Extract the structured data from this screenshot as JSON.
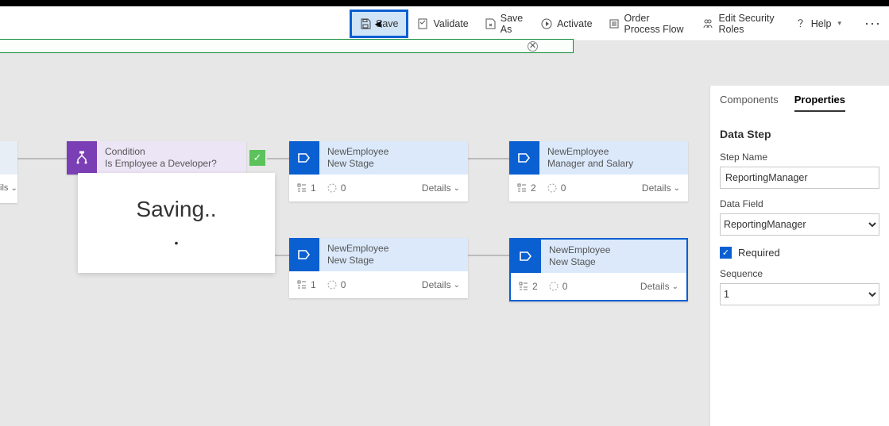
{
  "toolbar": {
    "save": "Save",
    "validate": "Validate",
    "save_as": "Save As",
    "activate": "Activate",
    "order": "Order Process Flow",
    "security": "Edit Security Roles",
    "help": "Help"
  },
  "saving_text": "Saving..",
  "partial_foot": "ils",
  "condition_node": {
    "line1": "Condition",
    "line2": "Is Employee a Developer?"
  },
  "stages": [
    {
      "line1": "NewEmployee",
      "line2": "New Stage",
      "count1": "1",
      "count2": "0",
      "details": "Details"
    },
    {
      "line1": "NewEmployee",
      "line2": "Manager and Salary",
      "count1": "2",
      "count2": "0",
      "details": "Details"
    },
    {
      "line1": "NewEmployee",
      "line2": "New Stage",
      "count1": "1",
      "count2": "0",
      "details": "Details"
    },
    {
      "line1": "NewEmployee",
      "line2": "New Stage",
      "count1": "2",
      "count2": "0",
      "details": "Details"
    }
  ],
  "tabs": {
    "components": "Components",
    "properties": "Properties"
  },
  "panel": {
    "heading": "Data Step",
    "step_name_label": "Step Name",
    "step_name_value": "ReportingManager",
    "data_field_label": "Data Field",
    "data_field_value": "ReportingManager",
    "required_label": "Required",
    "sequence_label": "Sequence",
    "sequence_value": "1"
  }
}
